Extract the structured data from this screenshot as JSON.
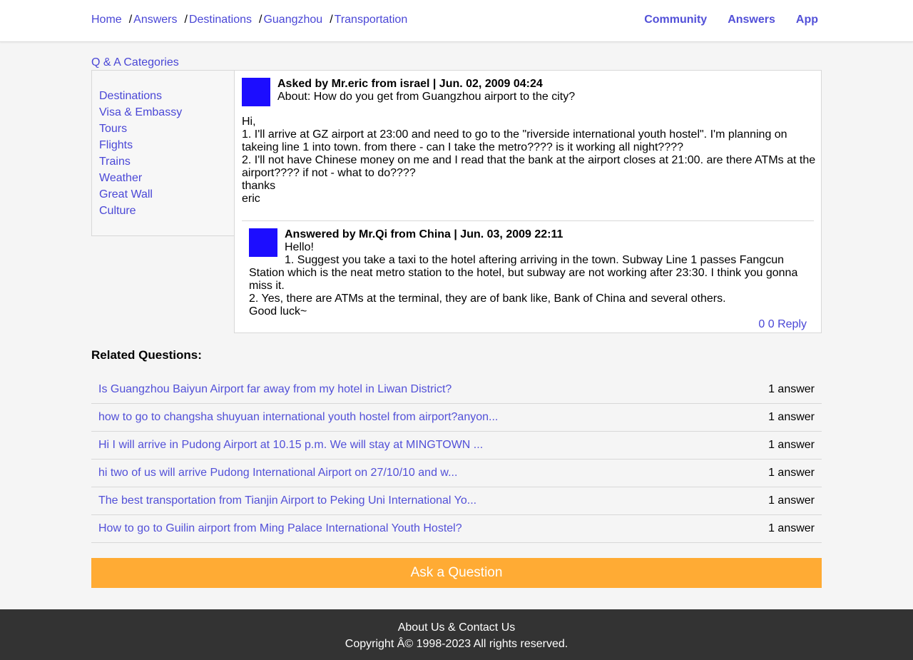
{
  "breadcrumb": [
    {
      "label": "Home"
    },
    {
      "label": "Answers"
    },
    {
      "label": "Destinations"
    },
    {
      "label": "Guangzhou"
    },
    {
      "label": "Transportation"
    }
  ],
  "breadcrumb_sep": "/",
  "topnav": {
    "community": "Community",
    "answers": "Answers",
    "app": "App"
  },
  "categories": {
    "title": "Q & A Categories",
    "items": [
      "Destinations",
      "Visa & Embassy",
      "Tours",
      "Flights",
      "Trains",
      "Weather",
      "Great Wall",
      "Culture"
    ]
  },
  "question": {
    "asked_by": "Asked by Mr.eric from israel | Jun. 02, 2009 04:24",
    "about": "About: How do you get from Guangzhou airport to the city?",
    "body": [
      "Hi,",
      "1. I'll arrive at GZ airport at 23:00 and need to go to the \"riverside international youth hostel\". I'm planning on takeing line 1 into town. from there - can I take the metro???? is it working all night????",
      "2. I'll not have Chinese money on me and I read that the bank at the airport closes at 21:00. are there ATMs at the airport???? if not - what to do????",
      "thanks",
      "eric"
    ]
  },
  "answer": {
    "answered_by": "Answered by Mr.Qi from China | Jun. 03, 2009 22:11",
    "body": [
      "Hello!",
      "1. Suggest you take a taxi to the hotel aftering arriving in the town. Subway Line 1 passes Fangcun Station which is the neat metro station to the hotel, but subway are not working after 23:30. I think you gonna miss it.",
      "2. Yes, there are ATMs at the terminal, they are of bank like, Bank of China and several others.",
      "Good luck~"
    ],
    "actions": "0 0 Reply"
  },
  "related": {
    "title": "Related Questions:",
    "rows": [
      {
        "q": "Is Guangzhou Baiyun Airport far away from my hotel in Liwan District?",
        "count": "1 answer"
      },
      {
        "q": "how to go to changsha shuyuan international youth hostel from airport?anyon...",
        "count": "1 answer"
      },
      {
        "q": "Hi I will arrive in Pudong Airport at 10.15 p.m. We will stay at MINGTOWN ...",
        "count": "1 answer"
      },
      {
        "q": "hi two of us will arrive Pudong International Airport on 27/10/10 and w...",
        "count": "1 answer"
      },
      {
        "q": "The best transportation from Tianjin Airport to Peking Uni International Yo...",
        "count": "1 answer"
      },
      {
        "q": "How to go to Guilin airport from Ming Palace International Youth Hostel?",
        "count": "1 answer"
      }
    ]
  },
  "ask_button": "Ask a Question",
  "footer": {
    "links": "About Us & Contact Us",
    "copyright": "Copyright Â© 1998-2023 All rights reserved."
  },
  "colors": {
    "link": "#4a47d6",
    "avatar": "#1c0dff",
    "ask_button": "#ffab34",
    "footer_bg": "#333333"
  }
}
